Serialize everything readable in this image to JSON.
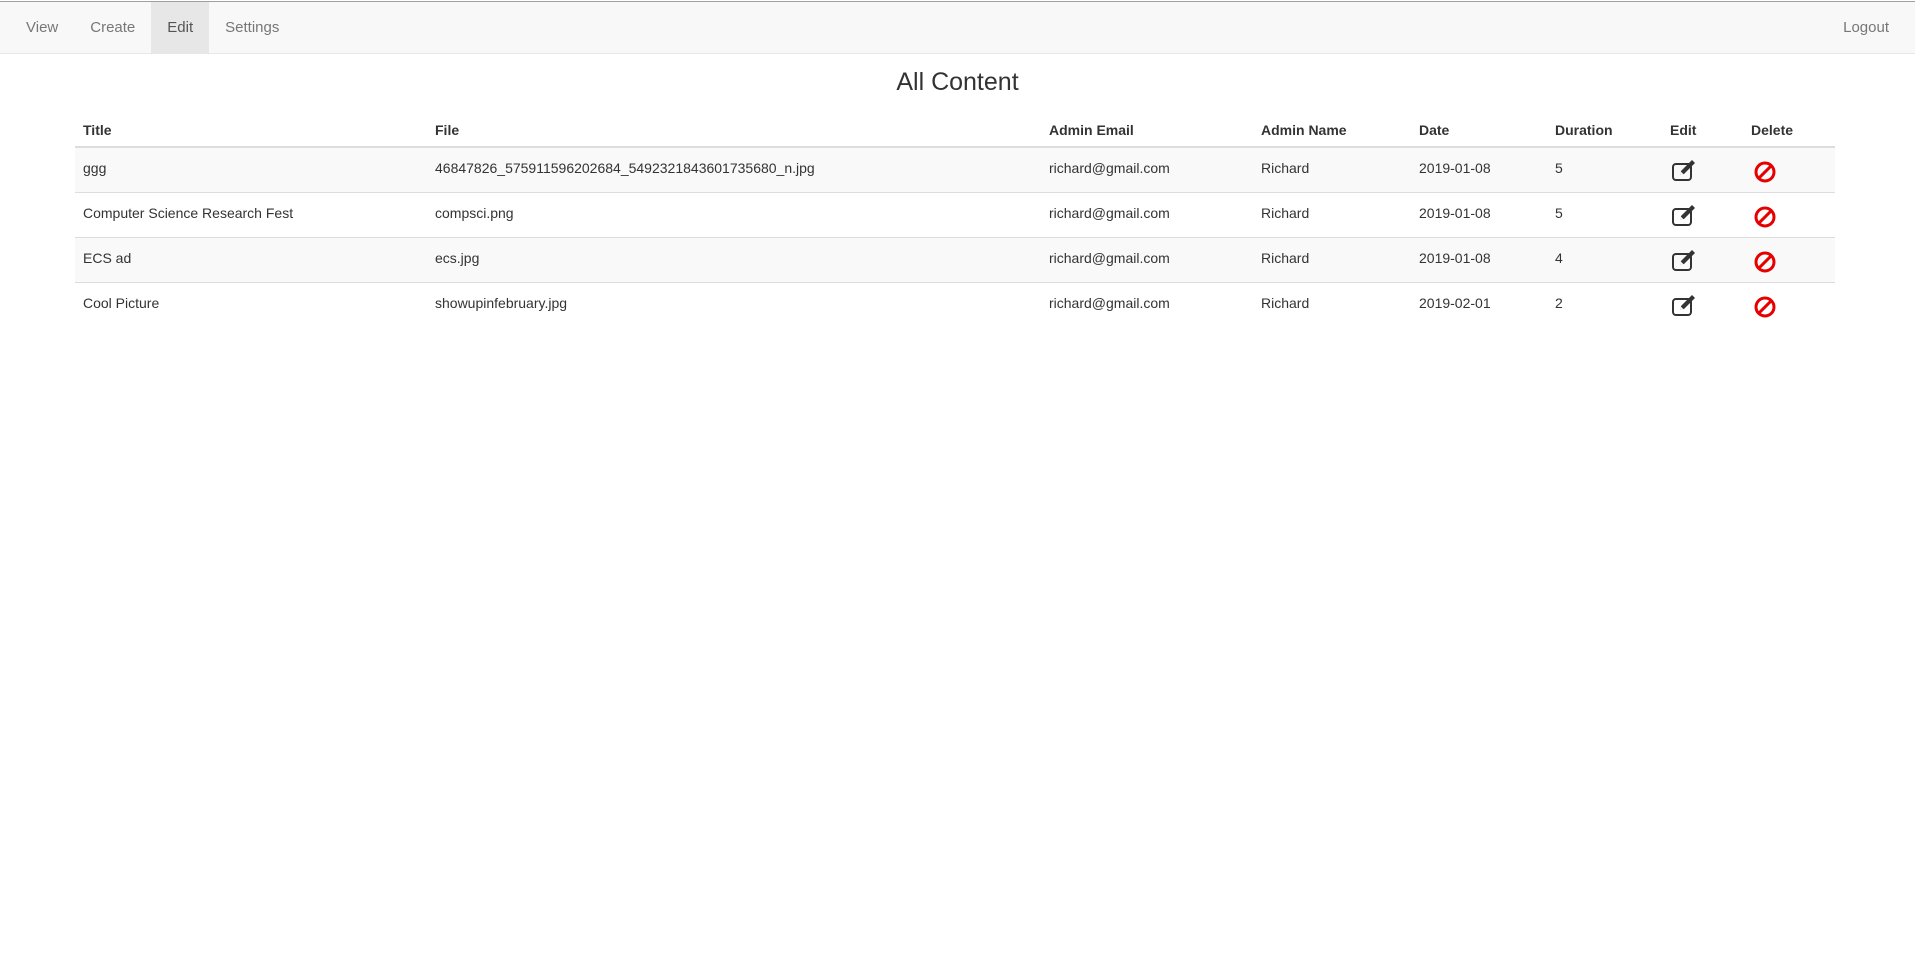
{
  "nav": {
    "items": [
      {
        "label": "View",
        "active": false
      },
      {
        "label": "Create",
        "active": false
      },
      {
        "label": "Edit",
        "active": true
      },
      {
        "label": "Settings",
        "active": false
      }
    ],
    "logout_label": "Logout"
  },
  "page": {
    "title": "All Content"
  },
  "table": {
    "columns": [
      "Title",
      "File",
      "Admin Email",
      "Admin Name",
      "Date",
      "Duration",
      "Edit",
      "Delete"
    ],
    "rows": [
      {
        "title": "ggg",
        "file": "46847826_575911596202684_5492321843601735680_n.jpg",
        "admin_email": "richard@gmail.com",
        "admin_name": "Richard",
        "date": "2019-01-08",
        "duration": "5"
      },
      {
        "title": "Computer Science Research Fest",
        "file": "compsci.png",
        "admin_email": "richard@gmail.com",
        "admin_name": "Richard",
        "date": "2019-01-08",
        "duration": "5"
      },
      {
        "title": "ECS ad",
        "file": "ecs.jpg",
        "admin_email": "richard@gmail.com",
        "admin_name": "Richard",
        "date": "2019-01-08",
        "duration": "4"
      },
      {
        "title": "Cool Picture",
        "file": "showupinfebruary.jpg",
        "admin_email": "richard@gmail.com",
        "admin_name": "Richard",
        "date": "2019-02-01",
        "duration": "2"
      }
    ],
    "edit_icon": "edit-icon",
    "delete_icon": "ban-icon"
  },
  "colors": {
    "delete_red": "#e60000",
    "nav_active_bg": "#e7e7e7"
  }
}
